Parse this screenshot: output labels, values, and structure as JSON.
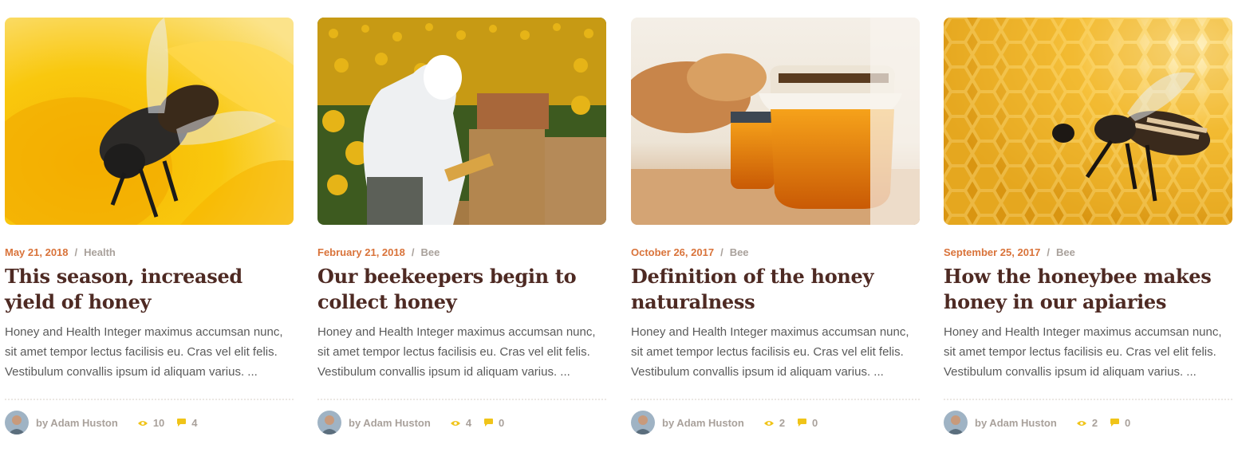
{
  "posts": [
    {
      "image": "bee-on-yellow-flower",
      "date": "May 21, 2018",
      "category": "Health",
      "title": "This season, increased yield of honey",
      "excerpt": "Honey and Health Integer maximus accumsan nunc, sit amet tempor lectus facilisis eu. Cras vel elit felis. Vestibulum convallis ipsum id aliquam varius. ...",
      "author": "by Adam Huston",
      "views": "10",
      "comments": "4"
    },
    {
      "image": "beekeeper-sunflower-field",
      "date": "February 21, 2018",
      "category": "Bee",
      "title": "Our beekeepers begin to collect honey",
      "excerpt": "Honey and Health Integer maximus accumsan nunc, sit amet tempor lectus facilisis eu. Cras vel elit felis. Vestibulum convallis ipsum id aliquam varius. ...",
      "author": "by Adam Huston",
      "views": "4",
      "comments": "0"
    },
    {
      "image": "honey-jar-with-bread",
      "date": "October 26, 2017",
      "category": "Bee",
      "title": "Definition of the honey naturalness",
      "excerpt": "Honey and Health Integer maximus accumsan nunc, sit amet tempor lectus facilisis eu. Cras vel elit felis. Vestibulum convallis ipsum id aliquam varius. ...",
      "author": "by Adam Huston",
      "views": "2",
      "comments": "0"
    },
    {
      "image": "bee-on-honeycomb",
      "date": "September 25, 2017",
      "category": "Bee",
      "title": "How the honeybee makes honey in our apiaries",
      "excerpt": "Honey and Health Integer maximus accumsan nunc, sit amet tempor lectus facilisis eu. Cras vel elit felis. Vestibulum convallis ipsum id aliquam varius. ...",
      "author": "by Adam Huston",
      "views": "2",
      "comments": "0"
    }
  ],
  "meta_separator": "/",
  "icons": {
    "views": "eye-icon",
    "comments": "comment-icon"
  },
  "colors": {
    "date": "#d9733a",
    "title": "#4e2a23",
    "muted": "#a9a19b",
    "icon": "#f0c419",
    "body_text": "#5a5a5a"
  }
}
